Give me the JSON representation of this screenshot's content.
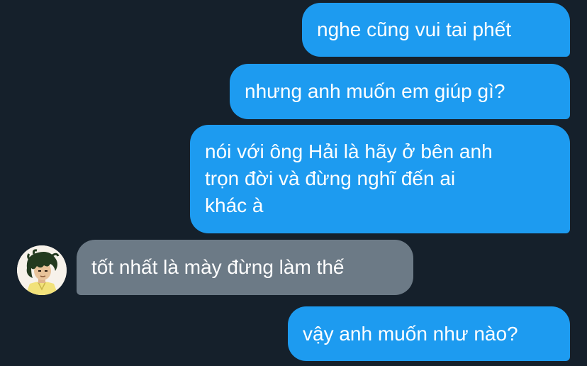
{
  "messages": [
    {
      "id": "m1",
      "direction": "outgoing",
      "text": "nghe cũng vui tai phết"
    },
    {
      "id": "m2",
      "direction": "outgoing",
      "text": "nhưng anh muốn em giúp gì?"
    },
    {
      "id": "m3",
      "direction": "outgoing",
      "text": "nói với ông Hải là hãy ở bên anh\ntrọn đời và đừng nghĩ đến ai\nkhác à"
    },
    {
      "id": "m4",
      "direction": "incoming",
      "text": "tốt nhất là mày đừng làm thế"
    },
    {
      "id": "m5",
      "direction": "outgoing",
      "text": "vậy anh muốn như nào?"
    }
  ],
  "contact": {
    "avatar_icon": "cartoon-person-avatar-icon"
  },
  "colors": {
    "background": "#15202b",
    "outgoing_bubble": "#1d9bf0",
    "incoming_bubble": "#6c7a86",
    "text": "#ffffff"
  }
}
